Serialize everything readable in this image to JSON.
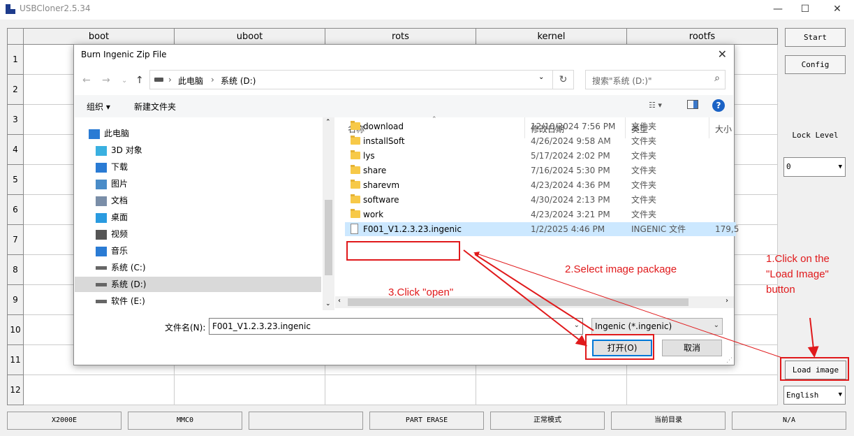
{
  "window": {
    "title": "USBCloner2.5.34",
    "minimize": "—",
    "maximize": "☐",
    "close": "✕"
  },
  "grid": {
    "columns": [
      "boot",
      "uboot",
      "rots",
      "kernel",
      "rootfs"
    ],
    "rows": [
      "1",
      "2",
      "3",
      "4",
      "5",
      "6",
      "7",
      "8",
      "9",
      "10",
      "11",
      "12"
    ]
  },
  "right_panel": {
    "start": "Start",
    "config": "Config",
    "lock_level_label": "Lock Level",
    "lock_level_value": "0",
    "load_image": "Load image",
    "language": "English"
  },
  "status_bar": [
    "X2000E",
    "MMC0",
    "",
    "PART ERASE",
    "正常模式",
    "当前目录",
    "N/A"
  ],
  "dialog": {
    "title": "Burn Ingenic Zip File",
    "breadcrumb": [
      "此电脑",
      "系统 (D:)"
    ],
    "search_placeholder": "搜索\"系统 (D:)\"",
    "organize": "组织 ▾",
    "new_folder": "新建文件夹",
    "tree": [
      {
        "label": "此电脑",
        "icon": "computer-icon"
      },
      {
        "label": "3D 对象",
        "icon": "3d-objects-icon"
      },
      {
        "label": "下载",
        "icon": "download-icon"
      },
      {
        "label": "图片",
        "icon": "pictures-icon"
      },
      {
        "label": "文档",
        "icon": "documents-icon"
      },
      {
        "label": "桌面",
        "icon": "desktop-icon"
      },
      {
        "label": "视频",
        "icon": "video-icon"
      },
      {
        "label": "音乐",
        "icon": "music-icon"
      },
      {
        "label": "系统 (C:)",
        "icon": "drive-icon"
      },
      {
        "label": "系统 (D:)",
        "icon": "drive-icon",
        "selected": true
      },
      {
        "label": "软件 (E:)",
        "icon": "drive-icon"
      }
    ],
    "list_headers": {
      "name": "名称",
      "modified": "修改日期",
      "type": "类型",
      "size": "大小"
    },
    "files": [
      {
        "name": "download",
        "date": "12/10/2024 7:56 PM",
        "type": "文件夹",
        "size": ""
      },
      {
        "name": "installSoft",
        "date": "4/26/2024 9:58 AM",
        "type": "文件夹",
        "size": ""
      },
      {
        "name": "lys",
        "date": "5/17/2024 2:02 PM",
        "type": "文件夹",
        "size": ""
      },
      {
        "name": "share",
        "date": "7/16/2024 5:30 PM",
        "type": "文件夹",
        "size": ""
      },
      {
        "name": "sharevm",
        "date": "4/23/2024 4:36 PM",
        "type": "文件夹",
        "size": ""
      },
      {
        "name": "software",
        "date": "4/30/2024 2:13 PM",
        "type": "文件夹",
        "size": ""
      },
      {
        "name": "work",
        "date": "4/23/2024 3:21 PM",
        "type": "文件夹",
        "size": ""
      },
      {
        "name": "F001_V1.2.3.23.ingenic",
        "date": "1/2/2025 4:46 PM",
        "type": "INGENIC 文件",
        "size": "179,5",
        "selected": true
      }
    ],
    "filename_label": "文件名(N):",
    "filename_value": "F001_V1.2.3.23.ingenic",
    "filetype": "Ingenic (*.ingenic)",
    "open_button": "打开(O)",
    "cancel_button": "取消"
  },
  "annotations": {
    "step1": "1.Click on the \"Load Image\" button",
    "step2": "2.Select image package",
    "step3": "3.Click \"open\"",
    "color": "#e0191b"
  }
}
